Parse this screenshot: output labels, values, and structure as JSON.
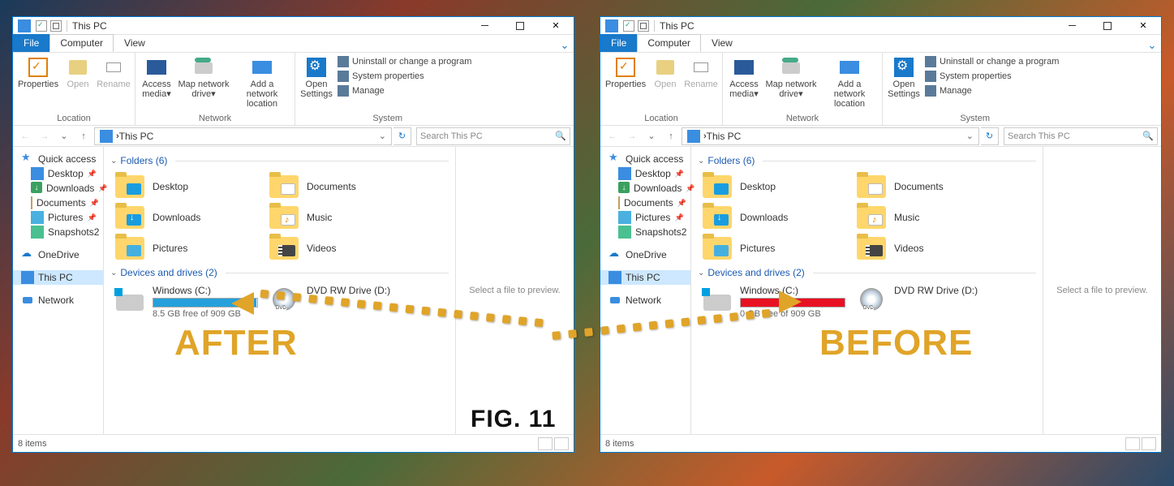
{
  "overlay": {
    "after": "AFTER",
    "before": "BEFORE",
    "fig": "FIG. 11"
  },
  "window": {
    "title": "This PC",
    "tabs": {
      "file": "File",
      "computer": "Computer",
      "view": "View"
    },
    "ribbon": {
      "location": {
        "name": "Location",
        "properties": "Properties",
        "open": "Open",
        "rename": "Rename"
      },
      "network": {
        "name": "Network",
        "access_media": "Access media",
        "map_drive": "Map network drive",
        "add_loc": "Add a network location"
      },
      "system": {
        "name": "System",
        "open_settings": "Open Settings",
        "uninstall": "Uninstall or change a program",
        "sys_props": "System properties",
        "manage": "Manage"
      }
    },
    "address": {
      "text": "This PC"
    },
    "search": {
      "placeholder": "Search This PC"
    },
    "nav": {
      "quick_access": "Quick access",
      "desktop": "Desktop",
      "downloads": "Downloads",
      "documents": "Documents",
      "pictures": "Pictures",
      "snapshots": "Snapshots2",
      "onedrive": "OneDrive",
      "this_pc": "This PC",
      "network": "Network"
    },
    "sections": {
      "folders": "Folders (6)",
      "drives": "Devices and drives (2)"
    },
    "folders": {
      "desktop": "Desktop",
      "documents": "Documents",
      "downloads": "Downloads",
      "music": "Music",
      "pictures": "Pictures",
      "videos": "Videos"
    },
    "drives": {
      "c_name": "Windows (C:)",
      "d_name": "DVD RW Drive (D:)"
    },
    "preview": "Select a file to preview.",
    "status": "8 items"
  },
  "after_drive": {
    "free_text": "8.5 GB free of 909 GB",
    "fill_pct": 99
  },
  "before_drive": {
    "free_text": "0 GB free of 909 GB",
    "fill_pct": 100
  }
}
